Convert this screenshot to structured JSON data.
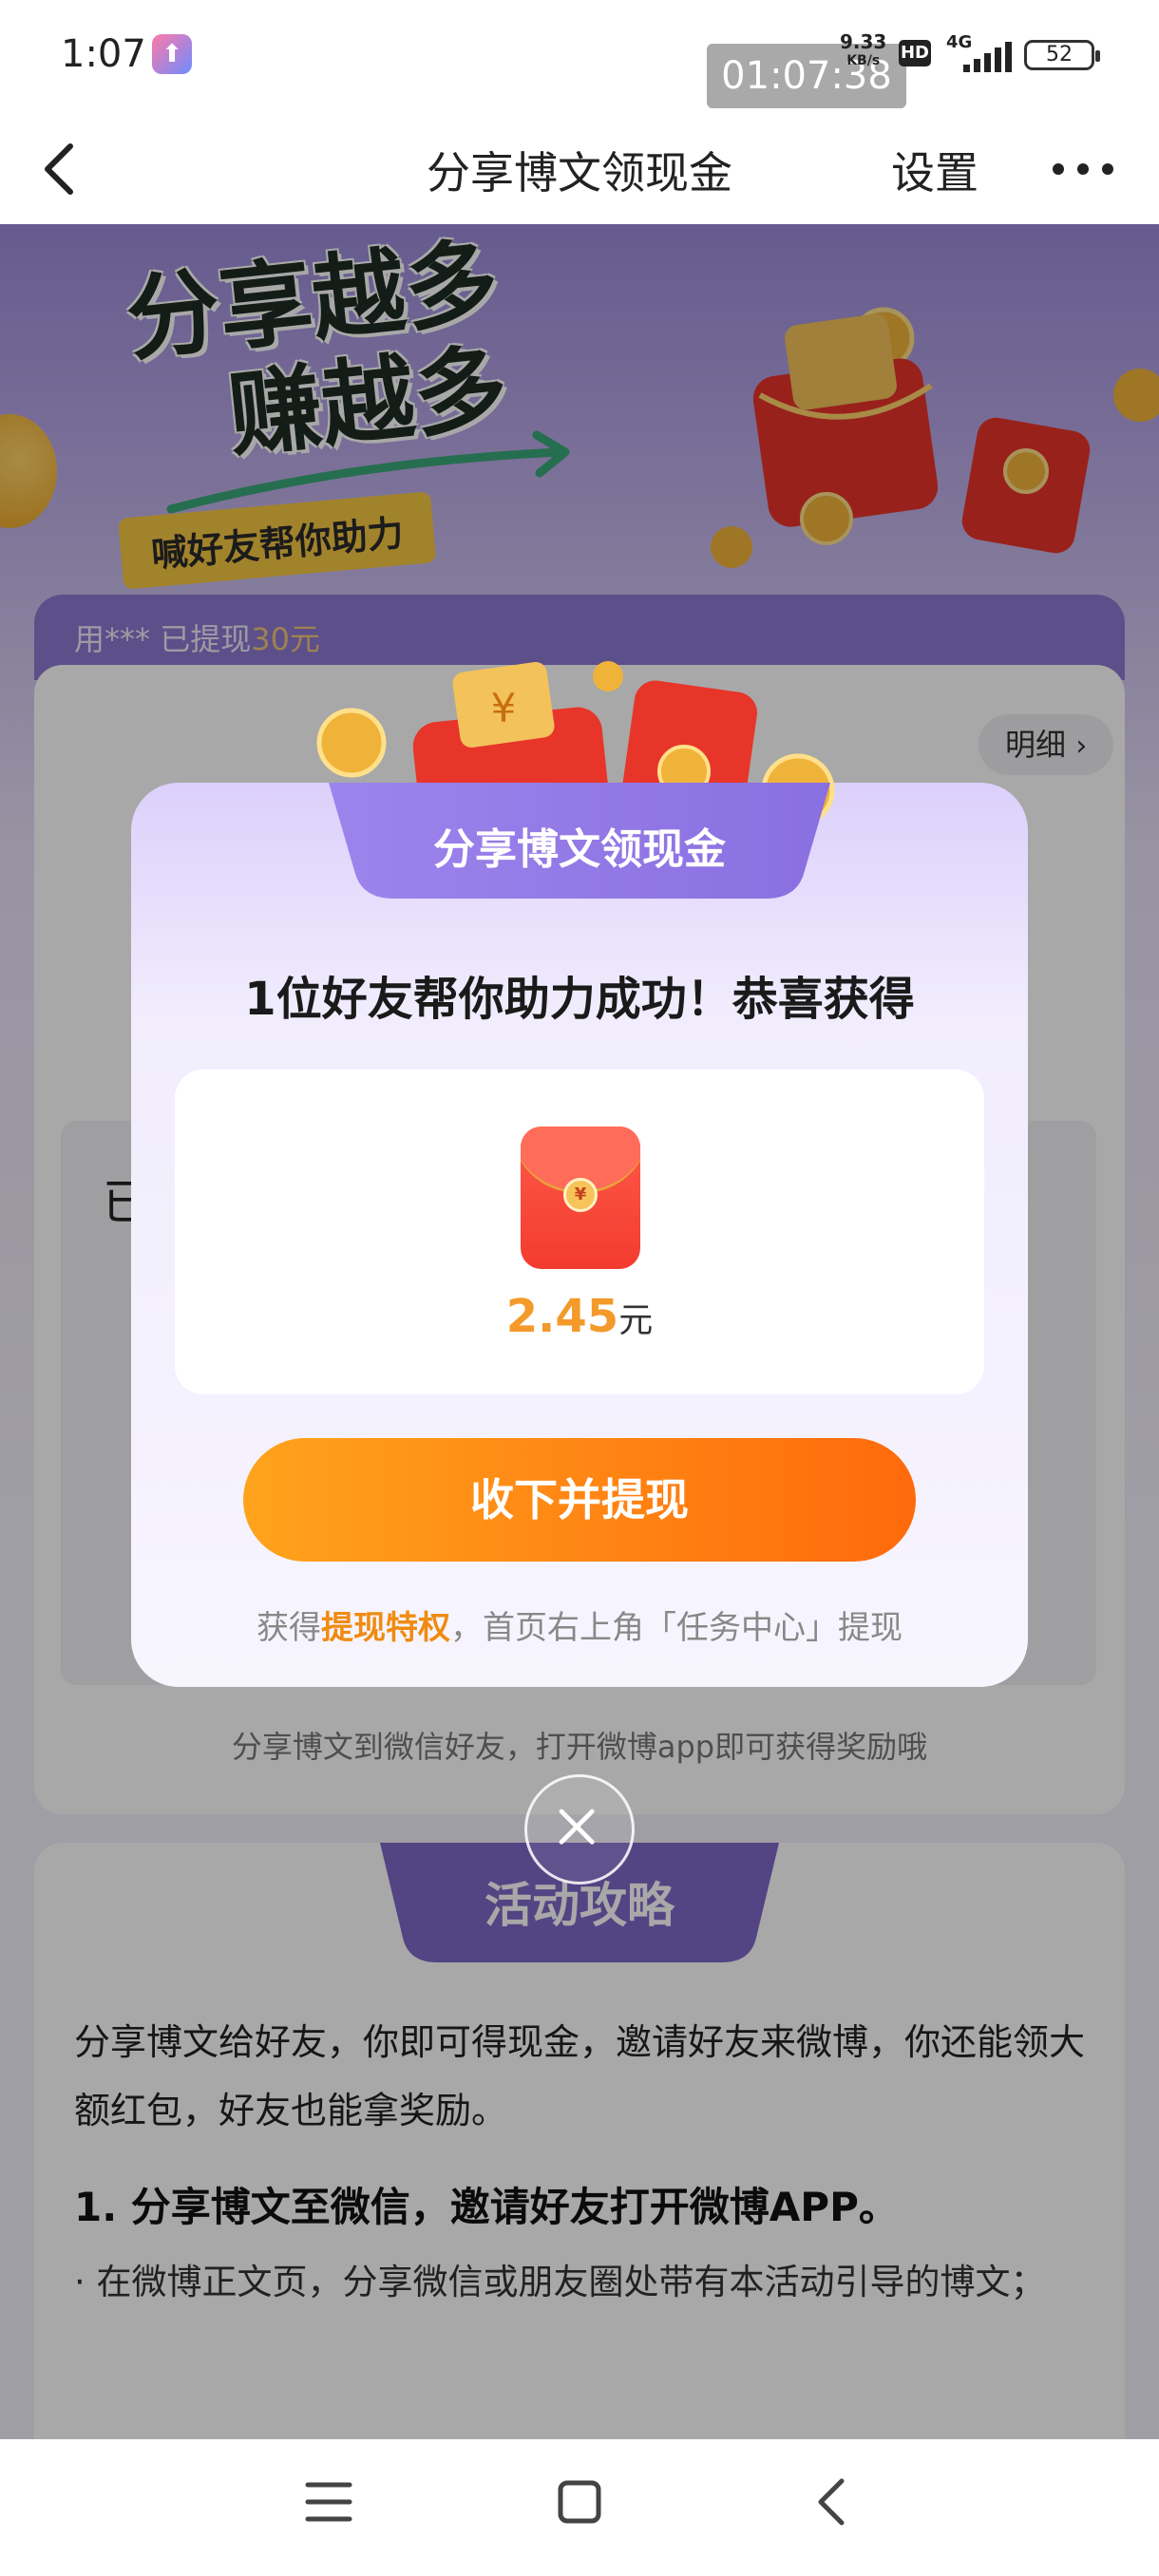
{
  "status_bar": {
    "time": "1:07",
    "recording_timer": "01:07:38",
    "network_speed": "9.33",
    "network_speed_unit": "KB/s",
    "hd_label": "HD",
    "network_type": "4G",
    "battery_level": "52"
  },
  "nav": {
    "title": "分享博文领现金",
    "settings_label": "设置"
  },
  "hero": {
    "title_line1": "分享越多",
    "title_line2": "赚越多",
    "badge_text": "喊好友帮你助力"
  },
  "notice": {
    "user_masked": "用***",
    "text": " 已提现",
    "amount": "30元"
  },
  "main_card": {
    "detail_label": "明细",
    "partial_char": "已",
    "share_hint": "分享博文到微信好友，打开微博app即可获得奖励哦"
  },
  "strategy": {
    "tab_title": "活动攻略",
    "intro": "分享博文给好友，你即可得现金，邀请好友来微博，你还能领大额红包，好友也能拿奖励。",
    "step1_title": "1. 分享博文至微信，邀请好友打开微博APP。",
    "step1_desc": "· 在微博正文页，分享微信或朋友圈处带有本活动引导的博文；"
  },
  "modal": {
    "header_title": "分享博文领现金",
    "message": "1位好友帮你助力成功！恭喜获得",
    "reward_amount": "2.45",
    "reward_unit": "元",
    "cta_label": "收下并提现",
    "note_prefix": "获得",
    "note_highlight": "提现特权",
    "note_suffix": "，首页右上角「任务中心」提现"
  },
  "colors": {
    "accent_orange": "#ff6a0c",
    "accent_purple": "#8d79d2",
    "highlight_text": "#f08b12"
  },
  "icons": {
    "back": "chevron-left-icon",
    "more": "more-dots-icon",
    "close": "close-icon",
    "menu": "menu-icon",
    "home": "home-icon",
    "sys_back": "back-icon"
  }
}
